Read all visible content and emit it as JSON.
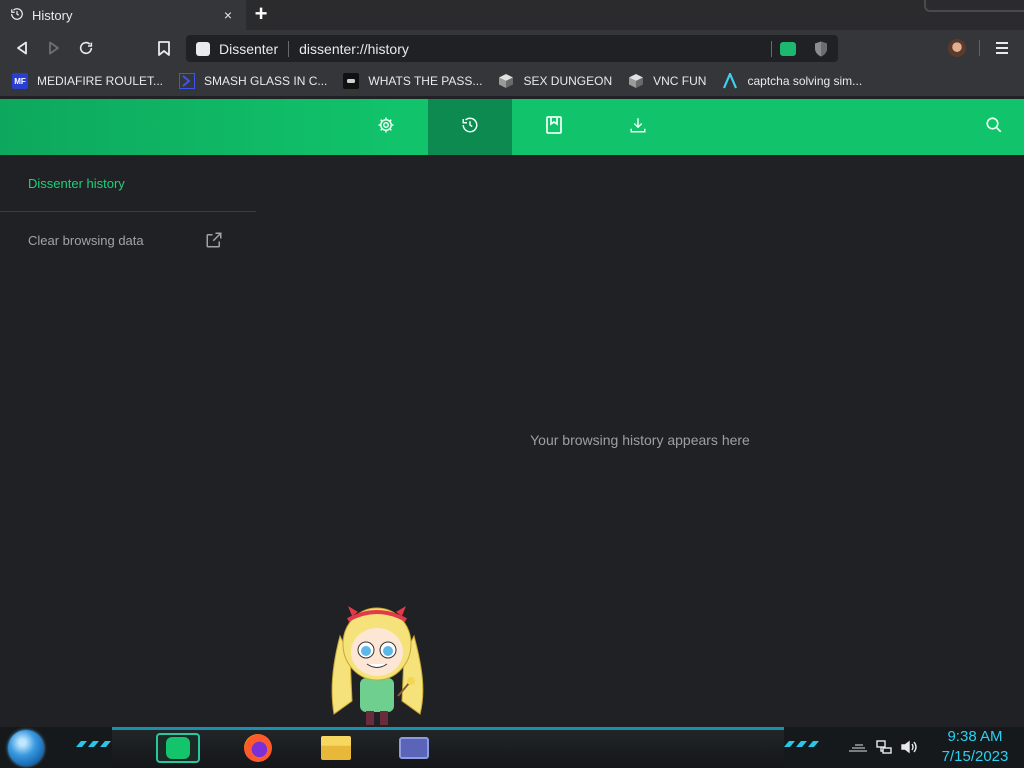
{
  "window": {
    "tab_title": "History",
    "tab_close": "×",
    "new_tab": "+"
  },
  "toolbar": {
    "site_name": "Dissenter",
    "url": "dissenter://history"
  },
  "bookmarks": [
    {
      "label": "MEDIAFIRE ROULET...",
      "icon": "mediafire-icon",
      "badge": "MF"
    },
    {
      "label": "SMASH GLASS IN C...",
      "icon": "chevron-bookmark-icon"
    },
    {
      "label": "WHATS THE PASS...",
      "icon": "discord-icon"
    },
    {
      "label": "SEX DUNGEON",
      "icon": "cube-icon"
    },
    {
      "label": "VNC FUN",
      "icon": "cube-icon"
    },
    {
      "label": "captcha solving sim...",
      "icon": "lambda-icon"
    }
  ],
  "nav": {
    "items": [
      "settings-icon",
      "history-icon",
      "bookmarks-icon",
      "downloads-icon"
    ],
    "active": "history-icon",
    "search": "search-icon"
  },
  "sidebar": {
    "title": "Dissenter history",
    "clear_label": "Clear browsing data"
  },
  "main": {
    "empty_message": "Your browsing history appears here"
  },
  "taskbar": {
    "apps": [
      "dissenter-app-icon",
      "firefox-icon",
      "file-explorer-icon",
      "app-window-icon"
    ],
    "time": "9:38 AM",
    "date": "7/15/2023"
  },
  "colors": {
    "accent": "#11c46b",
    "accent_dark": "#0c8a4f",
    "background": "#202124",
    "clock": "#2ad0f0"
  }
}
